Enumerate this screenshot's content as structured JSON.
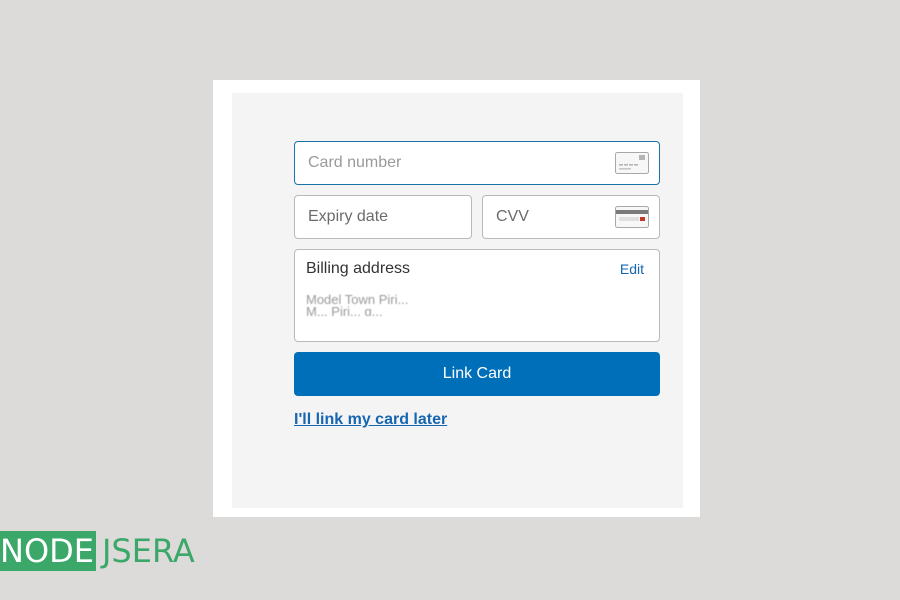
{
  "form": {
    "card_number_placeholder": "Card number",
    "expiry_placeholder": "Expiry date",
    "cvv_placeholder": "CVV",
    "billing": {
      "title": "Billing address",
      "edit_label": "Edit",
      "address_lines": [
        "Model Town Piri...",
        "M... Piri... g..."
      ]
    },
    "submit_label": "Link Card",
    "later_link_label": "I'll link my card later"
  },
  "branding": {
    "logo_left": "NODE",
    "logo_right": "JSERA"
  },
  "icons": {
    "card_number_icon": "credit-card-front-icon",
    "cvv_icon": "credit-card-back-icon"
  },
  "colors": {
    "primary_button": "#006fba",
    "link": "#1666b1",
    "focus_border": "#1a73a8",
    "logo_green": "#3ba86a"
  }
}
